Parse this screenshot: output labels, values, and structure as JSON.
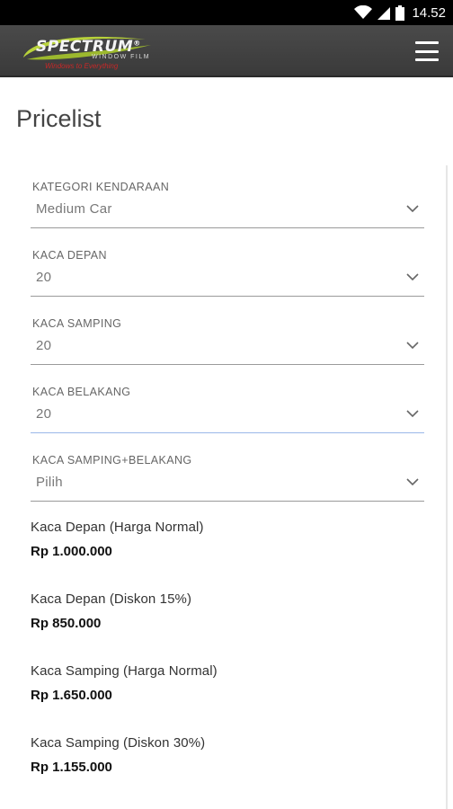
{
  "status_bar": {
    "time": "14.52",
    "icons": [
      "wifi-icon",
      "signal-icon",
      "battery-icon"
    ]
  },
  "app_bar": {
    "logo_text": "SPECTRUM",
    "logo_sub": "WINDOW FILM",
    "logo_tagline": "Windows to Everything",
    "menu_icon": "hamburger-menu-icon"
  },
  "page": {
    "title": "Pricelist"
  },
  "form": {
    "kategori": {
      "label": "KATEGORI KENDARAAN",
      "value": "Medium Car"
    },
    "kaca_depan": {
      "label": "KACA DEPAN",
      "value": "20"
    },
    "kaca_samping": {
      "label": "KACA SAMPING",
      "value": "20"
    },
    "kaca_belakang": {
      "label": "KACA BELAKANG",
      "value": "20"
    },
    "kaca_samping_belakang": {
      "label": "KACA SAMPING+BELAKANG",
      "value": "Pilih"
    }
  },
  "prices": [
    {
      "label": "Kaca Depan (Harga Normal)",
      "value": "Rp 1.000.000"
    },
    {
      "label": "Kaca Depan (Diskon 15%)",
      "value": "Rp 850.000"
    },
    {
      "label": "Kaca Samping (Harga Normal)",
      "value": "Rp 1.650.000"
    },
    {
      "label": "Kaca Samping (Diskon 30%)",
      "value": "Rp 1.155.000"
    }
  ],
  "colors": {
    "status_bar": "#000000",
    "app_bar": "#3f3f3f",
    "active_underline": "#9bb8e8",
    "logo_swoosh": "#b8d23a",
    "logo_tagline": "#c62828"
  }
}
